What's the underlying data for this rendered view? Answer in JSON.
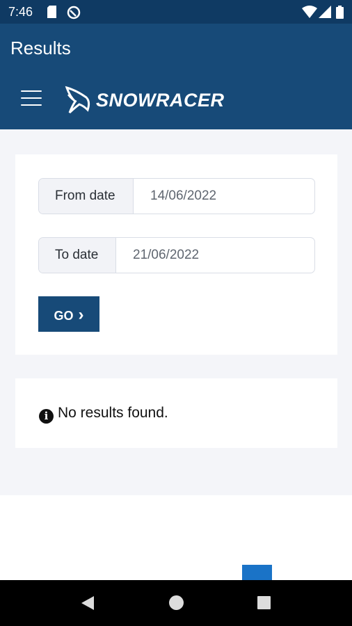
{
  "status_bar": {
    "time": "7:46"
  },
  "app_bar": {
    "title": "Results",
    "brand": "SNOWRACER"
  },
  "form": {
    "from_label": "From date",
    "from_value": "14/06/2022",
    "to_label": "To date",
    "to_value": "21/06/2022",
    "go_label": "GO",
    "go_chevron": "›"
  },
  "results": {
    "info_glyph": "i",
    "message": "No results found."
  },
  "icons": {
    "sim": "sim-card-icon",
    "no_disturb": "do-not-disturb-icon",
    "wifi": "wifi-icon",
    "signal": "signal-icon",
    "battery": "battery-icon",
    "menu": "hamburger-menu-icon",
    "info": "info-icon",
    "back": "nav-back-icon",
    "home": "nav-home-icon",
    "recent": "nav-recent-apps-icon"
  },
  "colors": {
    "primary": "#174a78",
    "status_bar": "#0f3a63",
    "background": "#f4f5f9",
    "accent": "#1a73c7"
  }
}
